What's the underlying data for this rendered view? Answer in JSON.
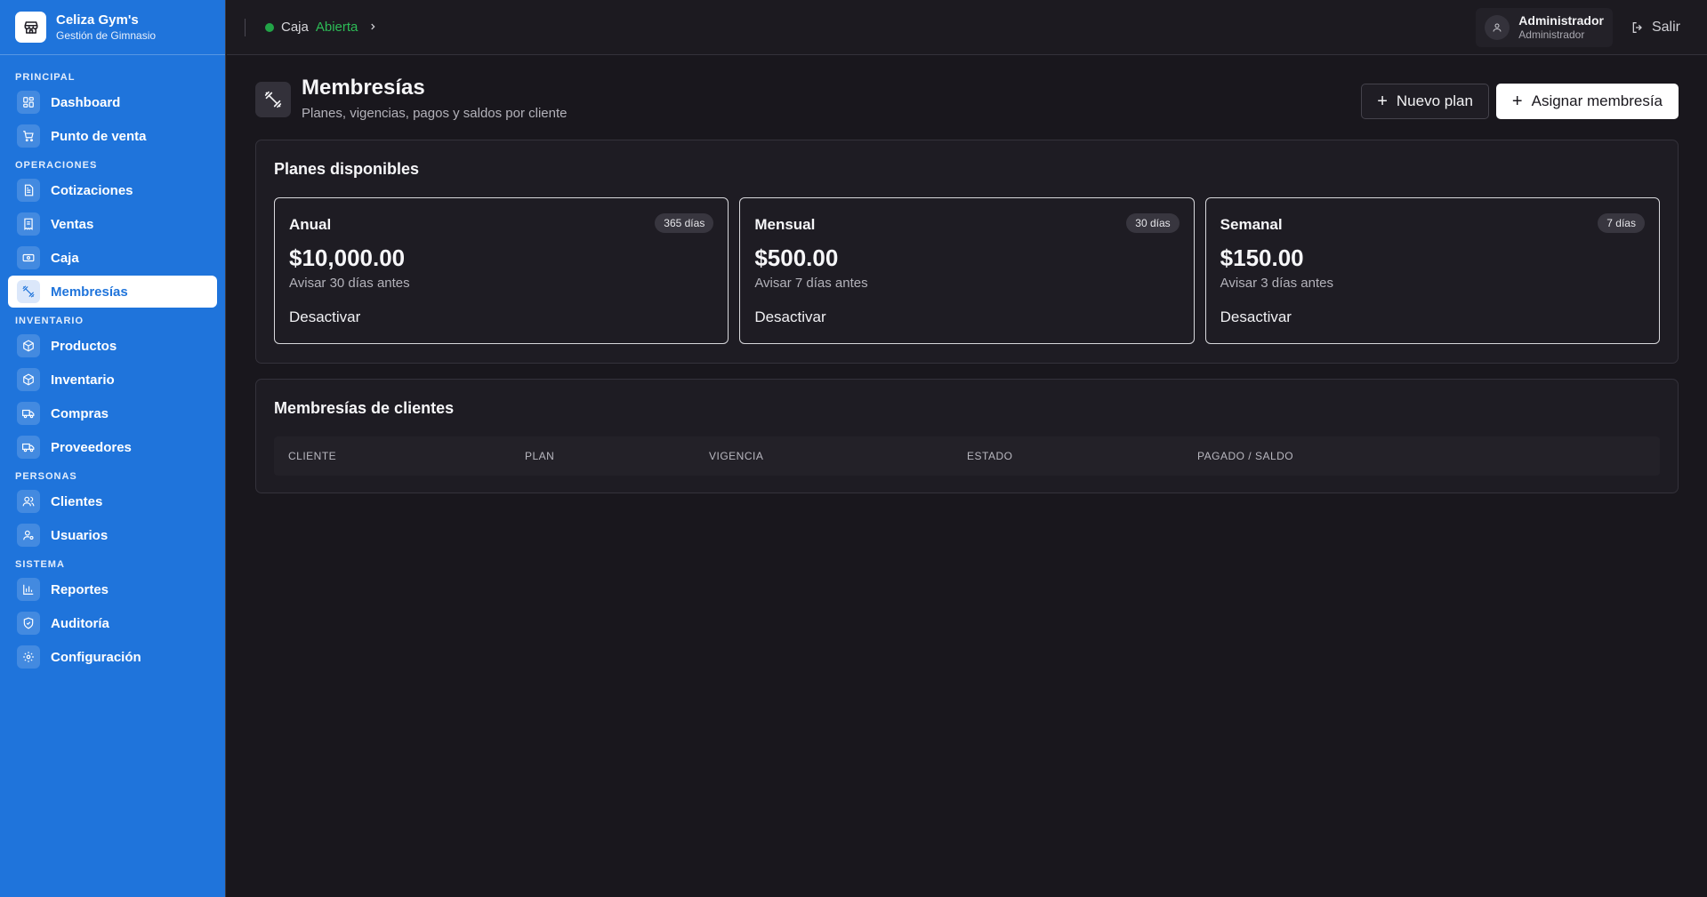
{
  "brand": {
    "title": "Celiza Gym's",
    "subtitle": "Gestión de Gimnasio"
  },
  "nav": {
    "sections": [
      {
        "label": "PRINCIPAL",
        "items": [
          {
            "label": "Dashboard",
            "icon": "dashboard-icon"
          },
          {
            "label": "Punto de venta",
            "icon": "cart-icon"
          }
        ]
      },
      {
        "label": "OPERACIONES",
        "items": [
          {
            "label": "Cotizaciones",
            "icon": "document-icon"
          },
          {
            "label": "Ventas",
            "icon": "receipt-icon"
          },
          {
            "label": "Caja",
            "icon": "cash-icon"
          },
          {
            "label": "Membresías",
            "icon": "dumbbell-icon",
            "active": true
          }
        ]
      },
      {
        "label": "INVENTARIO",
        "items": [
          {
            "label": "Productos",
            "icon": "box-icon"
          },
          {
            "label": "Inventario",
            "icon": "box-icon"
          },
          {
            "label": "Compras",
            "icon": "truck-icon"
          },
          {
            "label": "Proveedores",
            "icon": "truck-icon"
          }
        ]
      },
      {
        "label": "PERSONAS",
        "items": [
          {
            "label": "Clientes",
            "icon": "users-icon"
          },
          {
            "label": "Usuarios",
            "icon": "user-key-icon"
          }
        ]
      },
      {
        "label": "SISTEMA",
        "items": [
          {
            "label": "Reportes",
            "icon": "bar-chart-icon"
          },
          {
            "label": "Auditoría",
            "icon": "shield-icon"
          },
          {
            "label": "Configuración",
            "icon": "gear-icon"
          }
        ]
      }
    ]
  },
  "topbar": {
    "caja_label": "Caja",
    "caja_state": "Abierta",
    "status_color": "#22a447",
    "user_name": "Administrador",
    "user_role": "Administrador",
    "logout_label": "Salir"
  },
  "page": {
    "title": "Membresías",
    "subtitle": "Planes, vigencias, pagos y saldos por cliente",
    "new_plan_label": "Nuevo plan",
    "assign_label": "Asignar membresía"
  },
  "plans": {
    "title": "Planes disponibles",
    "items": [
      {
        "name": "Anual",
        "badge": "365 días",
        "price": "$10,000.00",
        "notice": "Avisar 30 días antes",
        "action": "Desactivar"
      },
      {
        "name": "Mensual",
        "badge": "30 días",
        "price": "$500.00",
        "notice": "Avisar 7 días antes",
        "action": "Desactivar"
      },
      {
        "name": "Semanal",
        "badge": "7 días",
        "price": "$150.00",
        "notice": "Avisar 3 días antes",
        "action": "Desactivar"
      }
    ]
  },
  "members": {
    "title": "Membresías de clientes",
    "columns": [
      "CLIENTE",
      "PLAN",
      "VIGENCIA",
      "ESTADO",
      "PAGADO / SALDO"
    ]
  },
  "colors": {
    "sidebar": "#1f74db",
    "background": "#19171d",
    "accent_green": "#2dbb56"
  }
}
